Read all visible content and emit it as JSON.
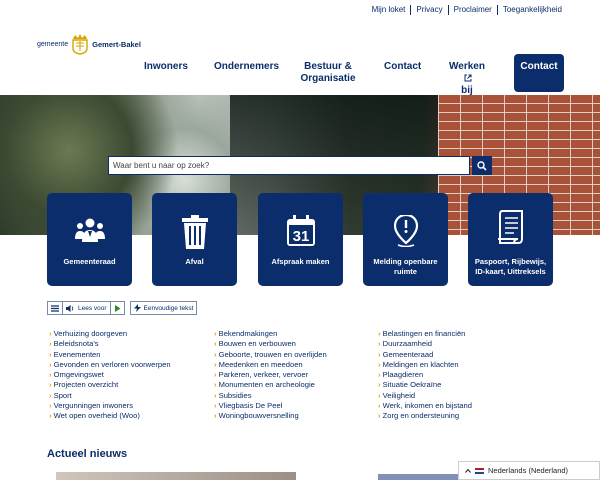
{
  "top_links": [
    "Mijn loket",
    "Privacy",
    "Proclaimer",
    "Toegankelijkheid"
  ],
  "logo": {
    "prefix": "gemeente",
    "name": "Gemert-Bakel"
  },
  "nav": {
    "inwoners": "Inwoners",
    "ondernemers": "Ondernemers",
    "bestuur_line1": "Bestuur &",
    "bestuur_line2": "Organisatie",
    "contact": "Contact",
    "werken_line1": "Werken",
    "werken_line2": "bij",
    "contact_button": "Contact"
  },
  "search": {
    "placeholder": "Waar bent u naar op zoek?"
  },
  "tiles": [
    {
      "label": "Gemeenteraad",
      "icon": "council-people-icon"
    },
    {
      "label": "Afval",
      "icon": "waste-bin-icon"
    },
    {
      "label": "Afspraak maken",
      "icon": "calendar-icon"
    },
    {
      "label_line1": "Melding openbare",
      "label_line2": "ruimte",
      "icon": "location-pin-alert-icon"
    },
    {
      "label_line1": "Paspoort, Rijbewijs,",
      "label_line2": "ID-kaart, Uittreksels",
      "icon": "document-scroll-icon"
    }
  ],
  "tools": {
    "read_aloud": "Lees voor",
    "simple_text": "Eenvoudige tekst"
  },
  "links": {
    "col1": [
      "Verhuizing doorgeven",
      "Beleidsnota's",
      "Evenementen",
      "Gevonden en verloren voorwerpen",
      "Omgevingswet",
      "Projecten overzicht",
      "Sport",
      "Vergunningen inwoners",
      "Wet open overheid (Woo)"
    ],
    "col2": [
      "Bekendmakingen",
      "Bouwen en verbouwen",
      "Geboorte, trouwen en overlijden",
      "Meedenken en meedoen",
      "Parkeren, verkeer, vervoer",
      "Monumenten en archeologie",
      "Subsidies",
      "Vliegbasis De Peel",
      "Woningbouwversnelling"
    ],
    "col3": [
      "Belastingen en financiën",
      "Duurzaamheid",
      "Gemeenteraad",
      "Meldingen en klachten",
      "Plaagdieren",
      "Situatie Oekraïne",
      "Veiligheid",
      "Werk, inkomen en bijstand",
      "Zorg en ondersteuning"
    ]
  },
  "news": {
    "heading": "Actueel nieuws"
  },
  "language": {
    "selected": "Nederlands (Nederland)"
  },
  "colors": {
    "primary": "#0b2d6b",
    "accent": "#d9a400"
  }
}
